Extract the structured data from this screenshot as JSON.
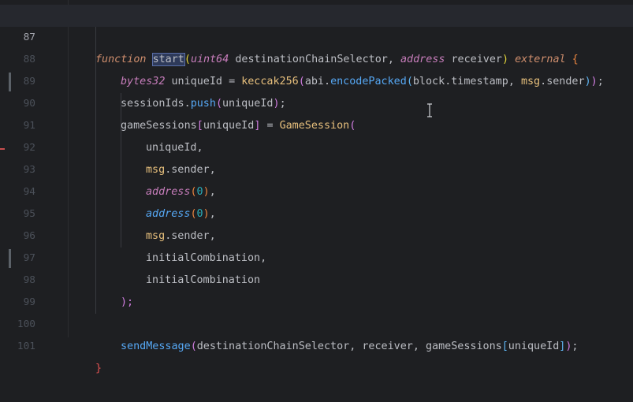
{
  "editor": {
    "lines": [
      {
        "number": "87",
        "current": true
      },
      {
        "number": "88"
      },
      {
        "number": "89"
      },
      {
        "number": "90"
      },
      {
        "number": "91"
      },
      {
        "number": "92"
      },
      {
        "number": "93"
      },
      {
        "number": "94"
      },
      {
        "number": "95"
      },
      {
        "number": "96"
      },
      {
        "number": "97"
      },
      {
        "number": "98"
      },
      {
        "number": "99"
      },
      {
        "number": "100"
      },
      {
        "number": "101"
      }
    ],
    "code": {
      "l87": {
        "kw": "function",
        "name": "start",
        "t1": "uint64",
        "p1": "destinationChainSelector",
        "t2": "address",
        "p2": "receiver",
        "mod": "external"
      },
      "l88": {
        "type": "bytes32",
        "var": "uniqueId",
        "eq": "=",
        "hash": "keccak256",
        "obj": "abi",
        "method": "encodePacked",
        "arg1obj": "block",
        "arg1prop": "timestamp",
        "arg2obj": "msg",
        "arg2prop": "sender"
      },
      "l89": {
        "obj": "sessionIds",
        "method": "push",
        "arg": "uniqueId"
      },
      "l90": {
        "obj": "gameSessions",
        "key": "uniqueId",
        "eq": "=",
        "struct": "GameSession"
      },
      "l91": {
        "text": "uniqueId,"
      },
      "l92": {
        "obj": "msg",
        "prop": "sender"
      },
      "l93": {
        "fn": "address",
        "num": "0"
      },
      "l94": {
        "fn": "address",
        "num": "0"
      },
      "l95": {
        "obj": "msg",
        "prop": "sender"
      },
      "l96": {
        "text": "initialCombination,"
      },
      "l97": {
        "text": "initialCombination"
      },
      "l98": {
        "text": ");"
      },
      "l100": {
        "fn": "sendMessage",
        "a1": "destinationChainSelector",
        "a2": "receiver",
        "a3obj": "gameSessions",
        "a3key": "uniqueId"
      },
      "l101": {
        "text": "}"
      }
    }
  },
  "colors": {
    "background": "#1e1f22",
    "current_line": "#26282e",
    "keyword": "#cf8e6d",
    "type": "#c77dbb",
    "function": "#56a8f5",
    "number": "#2aacb8"
  }
}
